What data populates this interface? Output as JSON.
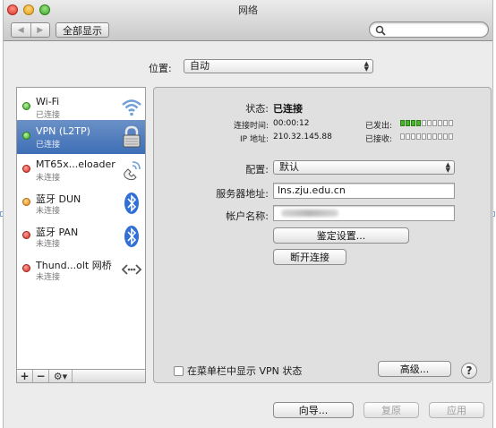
{
  "window": {
    "title": "网络",
    "show_all": "全部显示",
    "search_placeholder": ""
  },
  "location": {
    "label": "位置:",
    "value": "自动"
  },
  "services": [
    {
      "name": "Wi-Fi",
      "status": "已连接",
      "dot": "green",
      "icon": "wifi-icon",
      "selected": false
    },
    {
      "name": "VPN (L2TP)",
      "status": "已连接",
      "dot": "green",
      "icon": "lock-icon",
      "selected": true
    },
    {
      "name": "MT65x...eloader",
      "status": "未连接",
      "dot": "red",
      "icon": "phone-icon",
      "selected": false
    },
    {
      "name": "蓝牙 DUN",
      "status": "未连接",
      "dot": "orange",
      "icon": "bluetooth-icon",
      "selected": false
    },
    {
      "name": "蓝牙 PAN",
      "status": "未连接",
      "dot": "red",
      "icon": "bluetooth-icon",
      "selected": false
    },
    {
      "name": "Thund...olt 网桥",
      "status": "未连接",
      "dot": "red",
      "icon": "bridge-icon",
      "selected": false
    }
  ],
  "sidebar_tools": {
    "add": "+",
    "remove": "−",
    "gear": "⚙▾"
  },
  "detail": {
    "status_label": "状态:",
    "status_value": "已连接",
    "connect_time_label": "连接时间:",
    "connect_time_value": "00:00:12",
    "ip_label": "IP 地址:",
    "ip_value": "210.32.145.88",
    "sent_label": "已发出:",
    "sent_level": 0.4,
    "received_label": "已接收:",
    "received_level": 0.0,
    "config_label": "配置:",
    "config_value": "默认",
    "server_label": "服务器地址:",
    "server_value": "lns.zju.edu.cn",
    "account_label": "帐户名称:",
    "auth_button": "鉴定设置...",
    "disconnect_button": "断开连接",
    "show_vpn_label": "在菜单栏中显示 VPN 状态",
    "advanced_button": "高级...",
    "help": "?"
  },
  "footer": {
    "assistant": "向导...",
    "revert": "复原",
    "apply": "应用"
  },
  "colors": {
    "selection": "#3d6eb6",
    "meter_on": "#49b52b"
  }
}
